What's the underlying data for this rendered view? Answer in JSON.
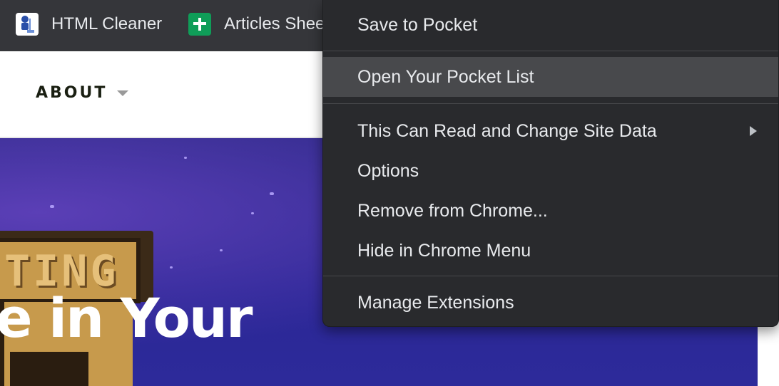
{
  "bookmarks": [
    {
      "label": "HTML Cleaner",
      "icon": "html-cleaner-icon"
    },
    {
      "label": "Articles Shee",
      "icon": "google-sheets-icon"
    }
  ],
  "site_nav": {
    "about_label": "ABOUT"
  },
  "hero": {
    "sign_text": "TING",
    "title": "e in Your"
  },
  "context_menu": {
    "items": [
      {
        "label": "Save to Pocket"
      },
      {
        "label": "Open Your Pocket List",
        "highlighted": true
      },
      {
        "label": "This Can Read and Change Site Data",
        "has_submenu": true
      },
      {
        "label": "Options"
      },
      {
        "label": "Remove from Chrome..."
      },
      {
        "label": "Hide in Chrome Menu"
      },
      {
        "label": "Manage Extensions"
      }
    ]
  },
  "colors": {
    "menu_bg": "#292a2d",
    "menu_highlight": "#48494c",
    "bookmarks_bar": "#35363a",
    "hero_bg": "#2b2796",
    "sheets_green": "#0f9d58"
  }
}
